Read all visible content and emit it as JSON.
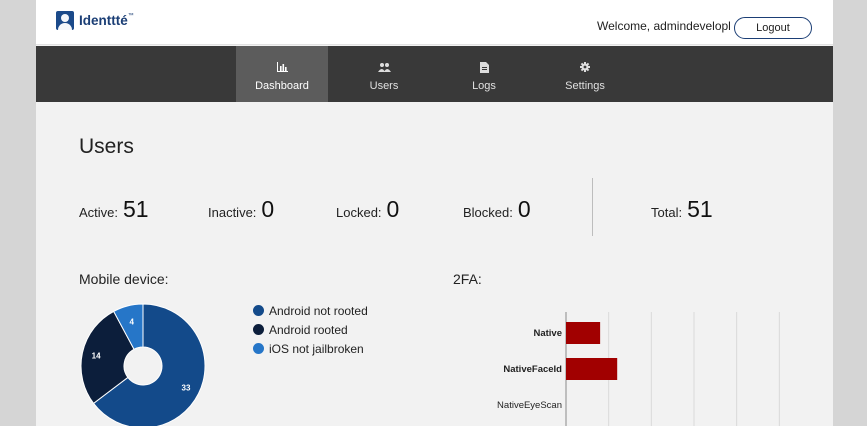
{
  "header": {
    "logo_text": "Identtté",
    "logo_tm": "™",
    "welcome": "Welcome, admindevelopl",
    "logout_label": "Logout"
  },
  "nav": {
    "items": [
      {
        "label": "Dashboard",
        "icon": "bar-chart-icon",
        "active": true
      },
      {
        "label": "Users",
        "icon": "users-icon",
        "active": false
      },
      {
        "label": "Logs",
        "icon": "document-icon",
        "active": false
      },
      {
        "label": "Settings",
        "icon": "gear-icon",
        "active": false
      }
    ]
  },
  "users": {
    "title": "Users",
    "stats": [
      {
        "label": "Active:",
        "value": "51"
      },
      {
        "label": "Inactive:",
        "value": "0"
      },
      {
        "label": "Locked:",
        "value": "0"
      },
      {
        "label": "Blocked:",
        "value": "0"
      },
      {
        "label": "Total:",
        "value": "51"
      }
    ]
  },
  "mobile": {
    "title": "Mobile device:"
  },
  "twofa": {
    "title": "2FA:"
  },
  "colors": {
    "accent": "#1b3e75",
    "nav_bg": "#393939",
    "nav_active": "#5c5c5c",
    "android_not_rooted": "#134a8a",
    "android_rooted": "#0c1e3b",
    "ios_not_jailbroken": "#2676c8",
    "bar": "#a10000"
  },
  "chart_data": [
    {
      "type": "pie",
      "donut": true,
      "slices": [
        {
          "label": "Android not rooted",
          "value": 33,
          "color": "#134a8a"
        },
        {
          "label": "Android rooted",
          "value": 14,
          "color": "#0c1e3b"
        },
        {
          "label": "iOS not jailbroken",
          "value": 4,
          "color": "#2676c8"
        }
      ],
      "legend": "right"
    },
    {
      "type": "bar",
      "orientation": "horizontal",
      "categories": [
        "Native",
        "NativeFaceId",
        "NativeEyeScan"
      ],
      "values": [
        8,
        12,
        0
      ],
      "xlim": [
        0,
        60
      ],
      "grid": true,
      "color": "#a10000"
    }
  ]
}
